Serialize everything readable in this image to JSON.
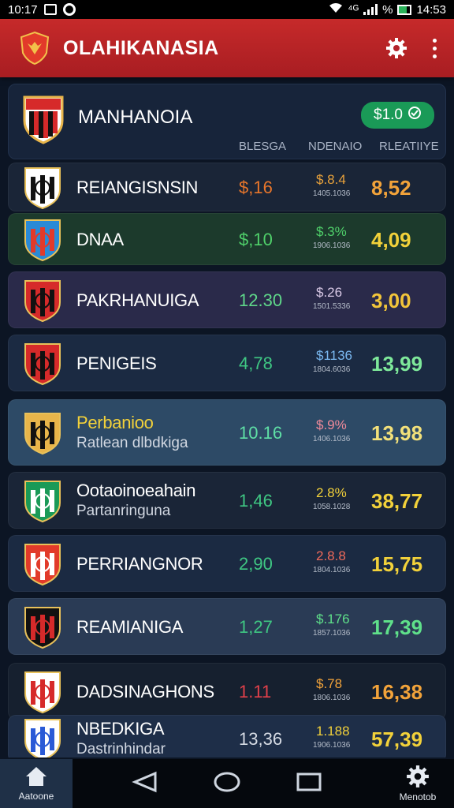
{
  "status_bar": {
    "time": "10:17",
    "indicators": "⁴ᴳ",
    "battery_pct": "%",
    "clock_right": "14:53"
  },
  "app_bar": {
    "title": "OLAHIKANASIA",
    "logo_icon": "team-crest-icon",
    "settings_icon": "gear-icon",
    "menu_icon": "more-vert-icon"
  },
  "header_card": {
    "title": "MANHANOIA",
    "balance": "$1.0",
    "balance_icon": "check-circle-icon",
    "columns": [
      "BLESGA",
      "NDENAIO",
      "RLEATIIYE"
    ]
  },
  "rows": [
    {
      "name": "REIANGISNSIN",
      "sub": "",
      "c1": "$,16",
      "c2": "$.8.4",
      "c2_sub": "1405.1036",
      "c3": "8,52",
      "bg": "#1a2537",
      "c1_color": "#e8762b",
      "c2_color": "#e8a23b",
      "c3_color": "#f2a33a"
    },
    {
      "name": "DNAA",
      "sub": "",
      "c1": "$,10",
      "c2": "$.3%",
      "c2_sub": "1906.1036",
      "c3": "4,09",
      "bg": "#1c3a2c",
      "c1_color": "#4fd06a",
      "c2_color": "#4fd06a",
      "c3_color": "#f2d13a"
    },
    {
      "name": "PAKRHANUIGA",
      "sub": "",
      "c1": "12.30",
      "c2": "$.26",
      "c2_sub": "1501.5336",
      "c3": "3,00",
      "bg": "#2a2a4a",
      "c1_color": "#5fd88a",
      "c2_color": "#d9c9e6",
      "c3_color": "#f2c53a"
    },
    {
      "name": "PENIGEIS",
      "sub": "",
      "c1": "4,78",
      "c2": "$1136",
      "c2_sub": "1804.6036",
      "c3": "13,99",
      "bg": "#1b2a42",
      "c1_color": "#3fc783",
      "c2_color": "#7ab8f0",
      "c3_color": "#7ee89a"
    },
    {
      "name": "Perbanioo",
      "sub": "Ratlean dlbdkiga",
      "c1": "10.16",
      "c2": "$.9%",
      "c2_sub": "1406.1036",
      "c3": "13,98",
      "bg": "#2d4a66",
      "c1_color": "#5fe0a6",
      "c2_color": "#f08a9a",
      "c3_color": "#f2e07a"
    },
    {
      "name": "Ootaoinoeahain",
      "sub": "Partanringuna",
      "c1": "1,46",
      "c2": "2.8%",
      "c2_sub": "1058.1028",
      "c3": "38,77",
      "bg": "#1a2537",
      "c1_color": "#3fc783",
      "c2_color": "#f2d13a",
      "c3_color": "#f2d13a"
    },
    {
      "name": "PERRIANGNOR",
      "sub": "",
      "c1": "2,90",
      "c2": "2.8.8",
      "c2_sub": "1804.1036",
      "c3": "15,75",
      "bg": "#1b2a42",
      "c1_color": "#3fc783",
      "c2_color": "#f06a5a",
      "c3_color": "#f2d13a"
    },
    {
      "name": "REAMIANIGA",
      "sub": "",
      "c1": "1,27",
      "c2": "$.176",
      "c2_sub": "1857.1036",
      "c3": "17,39",
      "bg": "#2a3b55",
      "c1_color": "#3fc783",
      "c2_color": "#5fe08a",
      "c3_color": "#5fe08a"
    },
    {
      "name": "DADSINAGHONS",
      "sub": "",
      "c1": "1.11",
      "c2": "$.78",
      "c2_sub": "1806.1036",
      "c3": "16,38",
      "bg": "#16202f",
      "c1_color": "#e0404a",
      "c2_color": "#f2a33a",
      "c3_color": "#f2a33a"
    },
    {
      "name": "NBEDKIGA",
      "sub": "Dastrinhindar",
      "c1": "13,36",
      "c2": "1.188",
      "c2_sub": "1906.1036",
      "c3": "57,39",
      "bg": "#1e2e48",
      "c1_color": "#d6dbe4",
      "c2_color": "#f2d13a",
      "c3_color": "#f2d13a"
    }
  ],
  "nav_bar": {
    "home_label": "Aatoone",
    "menu_label": "Menotob",
    "home_icon": "home-icon",
    "back_icon": "back-triangle-icon",
    "home_circle_icon": "home-circle-icon",
    "recents_icon": "recents-square-icon",
    "settings_icon": "gear-icon"
  }
}
